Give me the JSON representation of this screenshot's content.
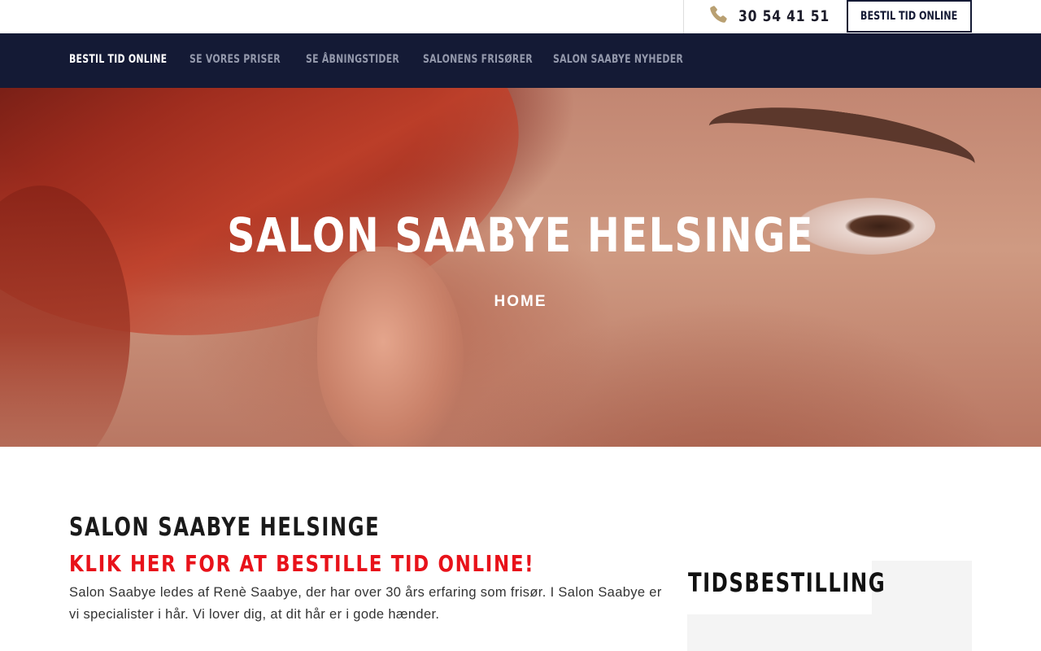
{
  "topbar": {
    "phone_icon": "phone-icon",
    "phone_number": "30 54 41 51",
    "cta_label": "BESTIL TID ONLINE"
  },
  "nav": {
    "items": [
      {
        "label": "BESTIL TID ONLINE",
        "active": true
      },
      {
        "label": "SE VORES PRISER",
        "active": false
      },
      {
        "label": "SE ÅBNINGSTIDER",
        "active": false
      },
      {
        "label": "SALONENS FRISØRER",
        "active": false
      },
      {
        "label": "SALON SAABYE NYHEDER",
        "active": false
      }
    ]
  },
  "hero": {
    "title": "SALON SAABYE HELSINGE",
    "breadcrumb": "HOME"
  },
  "content": {
    "heading": "SALON SAABYE HELSINGE",
    "cta_heading": "KLIK HER FOR AT BESTILLE TID ONLINE!",
    "paragraph": "Salon Saabye ledes af Renè Saabye, der har over 30 års erfaring som frisør. I Salon Saabye er vi specialister i hår. Vi lover dig, at dit hår er i gode hænder."
  },
  "sidebar": {
    "title": "TIDSBESTILLING"
  },
  "colors": {
    "nav_bg": "#141a35",
    "accent_gold": "#b9a072",
    "cta_red": "#e8121a"
  }
}
